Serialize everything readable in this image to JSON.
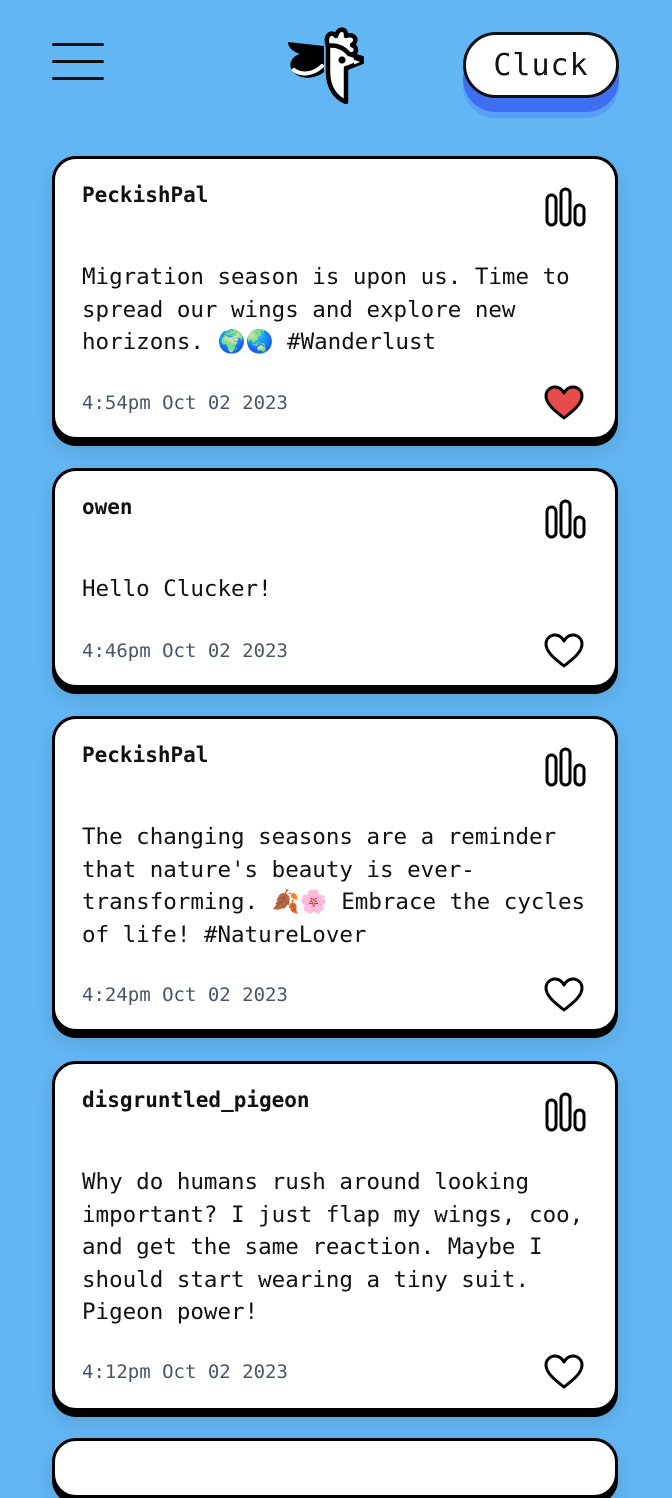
{
  "header": {
    "menu_icon": "hamburger-menu-icon",
    "logo_icon": "rooster-logo-icon",
    "cluck_label": "Cluck"
  },
  "colors": {
    "background": "#62b6f3",
    "button_shadow": "#3f6ff0",
    "heart_liked": "#e84b4b",
    "timestamp": "#4a5566"
  },
  "posts": [
    {
      "username": "PeckishPal",
      "message": "Migration season is upon us. Time to\nspread our wings and explore new\nhorizons. 🌍🌏 #Wanderlust",
      "timestamp": "4:54pm Oct 02 2023",
      "liked": true
    },
    {
      "username": "owen",
      "message": "Hello Clucker!",
      "timestamp": "4:46pm Oct 02 2023",
      "liked": false
    },
    {
      "username": "PeckishPal",
      "message": "The changing seasons are a reminder\nthat nature's beauty is ever-\ntransforming. 🍂🌸 Embrace the cycles\nof life! #NatureLover",
      "timestamp": "4:24pm Oct 02 2023",
      "liked": false
    },
    {
      "username": "disgruntled_pigeon",
      "message": "Why do humans rush around looking\nimportant? I just flap my wings, coo,\nand get the same reaction. Maybe I\nshould start wearing a tiny suit.\nPigeon power!",
      "timestamp": "4:12pm Oct 02 2023",
      "liked": false
    }
  ]
}
